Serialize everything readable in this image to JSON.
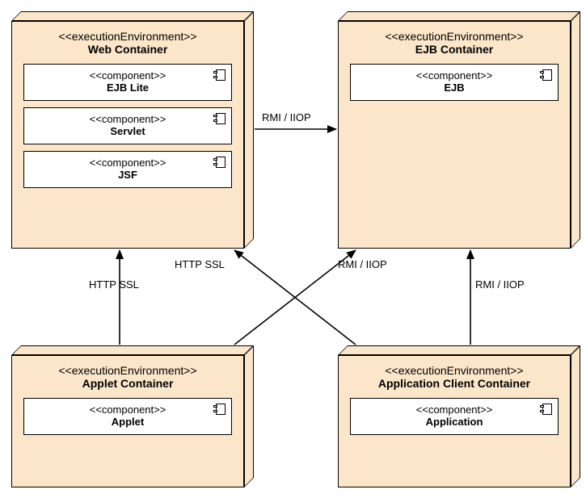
{
  "stereotypes": {
    "executionEnvironment": "<<executionEnvironment>>",
    "component": "<<component>>"
  },
  "containers": {
    "web": {
      "title": "Web Container",
      "components": [
        {
          "name": "EJB Lite"
        },
        {
          "name": "Servlet"
        },
        {
          "name": "JSF"
        }
      ]
    },
    "ejb": {
      "title": "EJB Container",
      "components": [
        {
          "name": "EJB"
        }
      ]
    },
    "applet": {
      "title": "Applet Container",
      "components": [
        {
          "name": "Applet"
        }
      ]
    },
    "appclient": {
      "title": "Application Client Container",
      "components": [
        {
          "name": "Application"
        }
      ]
    }
  },
  "connectors": {
    "web_to_ejb": "RMI / IIOP",
    "applet_to_web": "HTTP  SSL",
    "appclient_to_web": "HTTP SSL",
    "appclient_to_ejb": "RMI / IIOP",
    "applet_to_ejb": "RMI / IIOP"
  }
}
